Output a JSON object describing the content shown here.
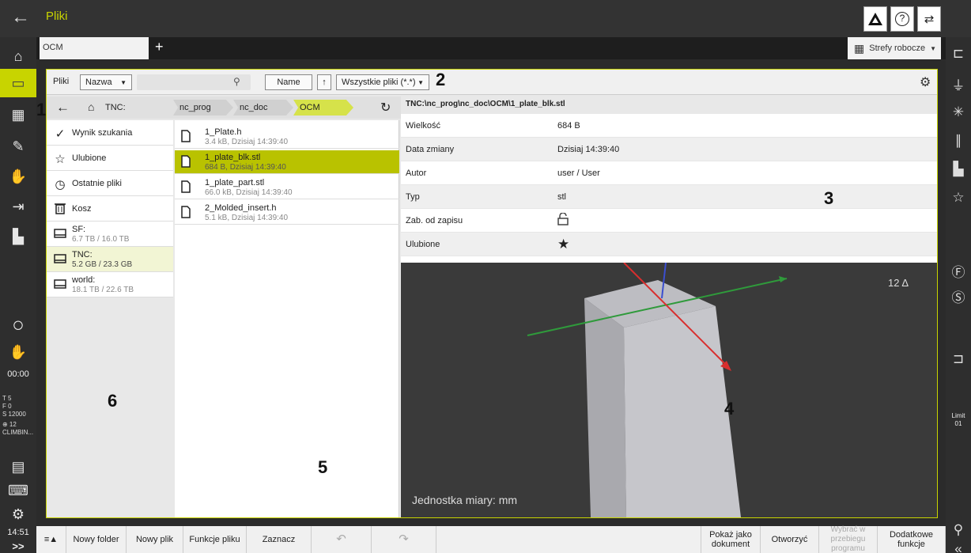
{
  "topbar": {
    "back_icon": "arrow-left-icon",
    "title": "Pliki",
    "right_icons": [
      "ocm-warning-icon",
      "help-icon",
      "switch-icon"
    ],
    "help_glyph": "?"
  },
  "leftrail": {
    "items": [
      "home-icon",
      "folder-icon",
      "table-icon",
      "edit-file-icon",
      "hand-icon",
      "run-icon",
      "machine-icon"
    ],
    "timer": "00:00",
    "status_lines": [
      "T      5",
      "F       0",
      "S 12000",
      "⊕    12",
      "CLIMBIN..."
    ],
    "clock": "14:51",
    "more": ">>"
  },
  "tabs": {
    "active": "OCM",
    "add": "+",
    "workzones_label": "Strefy robocze",
    "workzones_arrow": "▼"
  },
  "toolbar": {
    "label": "Pliki",
    "sort_select": "Nazwa",
    "sort_arrow": "▼",
    "search_placeholder": "",
    "name_button": "Name",
    "direction_button": "↑",
    "filter_select": "Wszystkie pliki (*.*)",
    "filter_arrow": "▼"
  },
  "breadcrumb": {
    "back": "←",
    "home": "⌂",
    "items": [
      "TNC:",
      "nc_prog",
      "nc_doc",
      "OCM"
    ],
    "refresh": "↻"
  },
  "nav": {
    "items": [
      {
        "label": "Wynik szukania",
        "icon": "check-circle-icon",
        "glyph": "✓"
      },
      {
        "label": "Ulubione",
        "icon": "star-icon",
        "glyph": "☆"
      },
      {
        "label": "Ostatnie pliki",
        "icon": "clock-icon",
        "glyph": "◷"
      },
      {
        "label": "Kosz",
        "icon": "trash-icon",
        "glyph": "🗑"
      },
      {
        "label": "SF:",
        "sub": "6.7 TB / 16.0 TB",
        "icon": "drive-icon"
      },
      {
        "label": "TNC:",
        "sub": "5.2 GB / 23.3 GB",
        "icon": "drive-icon"
      },
      {
        "label": "world:",
        "sub": "18.1 TB / 22.6 TB",
        "icon": "drive-icon"
      }
    ]
  },
  "files": [
    {
      "name": "1_Plate.h",
      "meta": "3.4 kB, Dzisiaj 14:39:40"
    },
    {
      "name": "1_plate_blk.stl",
      "meta": "684 B, Dzisiaj 14:39:40"
    },
    {
      "name": "1_plate_part.stl",
      "meta": "66.0 kB, Dzisiaj 14:39:40"
    },
    {
      "name": "2_Molded_insert.h",
      "meta": "5.1 kB, Dzisiaj 14:39:40"
    }
  ],
  "detail": {
    "path": "TNC:\\nc_prog\\nc_doc\\OCM\\1_plate_blk.stl",
    "props": [
      {
        "key": "Wielkość",
        "value": "684 B"
      },
      {
        "key": "Data zmiany",
        "value": "Dzisiaj 14:39:40"
      },
      {
        "key": "Autor",
        "value": "user / User"
      },
      {
        "key": "Typ",
        "value": "stl"
      },
      {
        "key": "Zab. od zapisu",
        "value": "",
        "icon": "unlock-icon"
      },
      {
        "key": "Ulubione",
        "value": "",
        "icon": "star-filled-icon"
      }
    ],
    "viewport_triangles": "12 Δ",
    "viewport_unit": "Jednostka miary: mm"
  },
  "callouts": [
    "1",
    "2",
    "3",
    "4",
    "5",
    "6"
  ],
  "bottom": {
    "menu": "≡▲",
    "buttons": [
      "Nowy folder",
      "Nowy plik",
      "Funkcje pliku",
      "Zaznacz"
    ],
    "undo": "↶",
    "redo": "↷",
    "right_buttons": [
      {
        "label": "Pokaż jako dokument",
        "disabled": false
      },
      {
        "label": "Otworzyć",
        "disabled": false
      },
      {
        "label": "Wybrać w przebiegu programu",
        "disabled": true
      },
      {
        "label": "Dodatkowe funkcje",
        "disabled": false
      }
    ]
  },
  "rightrail": {
    "limit_label": "Limit",
    "limit_value": "01",
    "collapse": "«"
  },
  "colors": {
    "accent": "#c8d400",
    "selected_file": "#b9c200"
  }
}
